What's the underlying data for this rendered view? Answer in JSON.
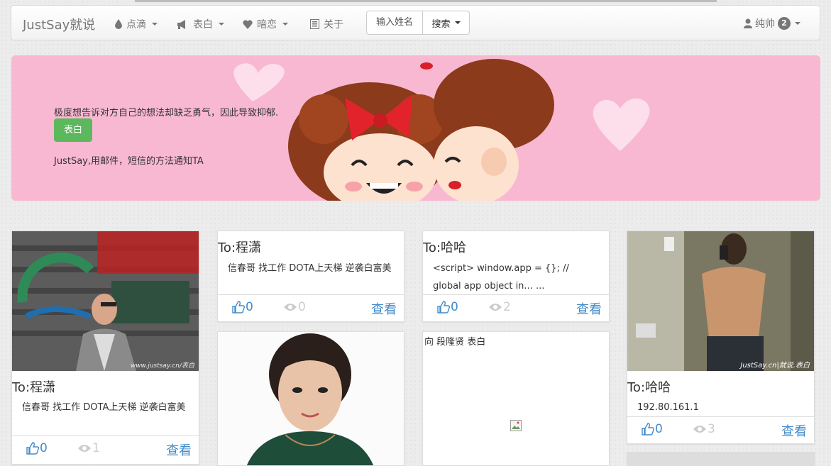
{
  "navbar": {
    "brand": "JustSay就说",
    "items": [
      {
        "label": "点滴",
        "icon": "drop-icon",
        "dropdown": true
      },
      {
        "label": "表白",
        "icon": "bullhorn-icon",
        "dropdown": true
      },
      {
        "label": "暗恋",
        "icon": "heart-icon",
        "dropdown": true
      },
      {
        "label": "关于",
        "icon": "list-icon",
        "dropdown": false
      }
    ],
    "search": {
      "placeholder": "输入姓名",
      "button": "搜索"
    },
    "user": {
      "name": "纯帅",
      "badge": "2"
    }
  },
  "hero": {
    "text1": "极度想告诉对方自己的想法却缺乏勇气，因此导致抑郁.",
    "button": "表白",
    "text2": "JustSay,用邮件，短信的方法通知TA"
  },
  "cards": [
    {
      "title": "To:程潇",
      "text": "信春哥 找工作 DOTA上天梯 逆袭白富美",
      "likes": "0",
      "views": "1",
      "more": "查看",
      "image": "photo-man-landmark",
      "image_caption": "www.justsay.cn/表白"
    },
    {
      "title": "To:程潇",
      "text": "信春哥 找工作 DOTA上天梯 逆袭白富美",
      "likes": "0",
      "views": "0",
      "more": "查看"
    },
    {
      "title": "To:哈哈",
      "text": "<script> window.app = {}; // global app object in... ...",
      "likes": "0",
      "views": "2",
      "more": "查看"
    },
    {
      "title": "To:哈哈",
      "text": "192.80.161.1",
      "likes": "0",
      "views": "3",
      "more": "查看",
      "image": "photo-mirror-selfie",
      "image_caption": "JustSay.cn|就说.表白"
    },
    {
      "image": "photo-girl-portrait"
    },
    {
      "header": "向 段隆贤 表白",
      "image": "broken-image-icon"
    }
  ],
  "colors": {
    "accent": "#428bca",
    "success": "#5cb85c",
    "hero_bg": "#f9b8d2"
  }
}
